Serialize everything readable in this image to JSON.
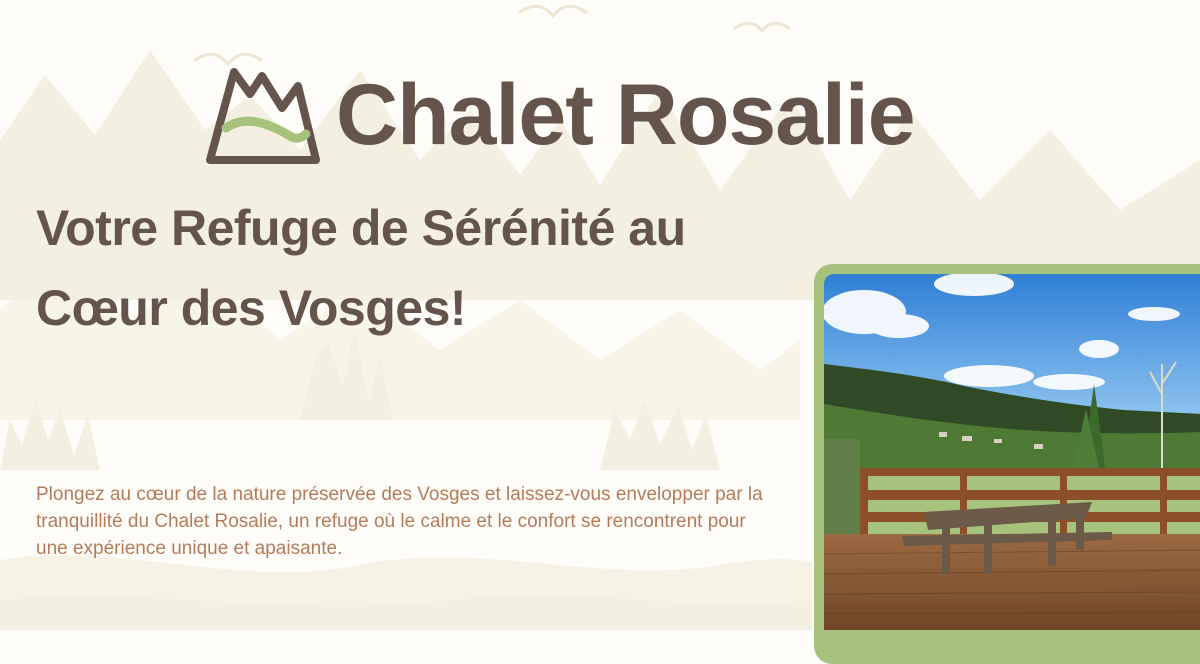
{
  "brand": {
    "name": "Chalet Rosalie",
    "logo_icon": "mountain-icon"
  },
  "hero": {
    "headline": "Votre Refuge de Sérénité au Cœur des Vosges!",
    "description": "Plongez au cœur de la nature préservée des Vosges et laissez-vous envelopper par la tranquillité du Chalet Rosalie, un refuge où le calme et le confort se rencontrent pour une expérience unique et apaisante."
  },
  "photo": {
    "subject": "wooden-deck-with-picnic-table-and-mountain-view"
  },
  "colors": {
    "brand_brown": "#65544b",
    "text_terracotta": "#b47c5a",
    "accent_green": "#a6c27d",
    "background_cream": "#fefdf9",
    "mountain_beige": "#f3efe0"
  }
}
